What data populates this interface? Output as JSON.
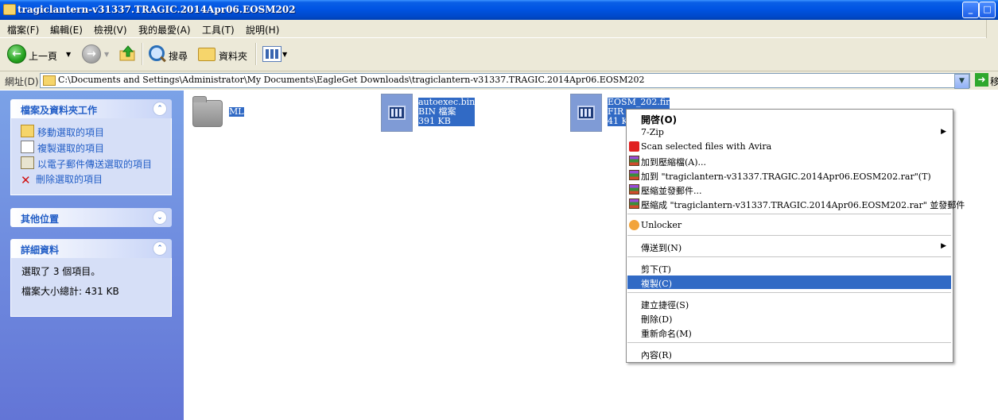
{
  "window": {
    "title": "tragiclantern-v31337.TRAGIC.2014Apr06.EOSM202",
    "min_label": "_",
    "max_label": "□"
  },
  "menu": [
    "檔案(F)",
    "編輯(E)",
    "檢視(V)",
    "我的最愛(A)",
    "工具(T)",
    "說明(H)"
  ],
  "toolbar": {
    "back_label": "上一頁",
    "search_label": "搜尋",
    "folders_label": "資料夾"
  },
  "address": {
    "label": "網址(D)",
    "path": "C:\\Documents and Settings\\Administrator\\My Documents\\EagleGet Downloads\\tragiclantern-v31337.TRAGIC.2014Apr06.EOSM202",
    "go_label": "移"
  },
  "taskpane": {
    "file_tasks": {
      "title": "檔案及資料夾工作",
      "items": [
        "移動選取的項目",
        "複製選取的項目",
        "以電子郵件傳送選取的項目",
        "刪除選取的項目"
      ]
    },
    "other_places": {
      "title": "其他位置"
    },
    "details": {
      "title": "詳細資料",
      "selected": "選取了 3 個項目。",
      "size": "檔案大小總計: 431 KB"
    }
  },
  "files": [
    {
      "name": "ML",
      "type": "folder"
    },
    {
      "name": "autoexec.bin",
      "type_label": "BIN 檔案",
      "size": "391 KB"
    },
    {
      "name": "EOSM_202.fir",
      "type_label": "FIR",
      "size": "41 K"
    }
  ],
  "context_menu": {
    "items": [
      {
        "label": "開啓(O)",
        "bold": true
      },
      {
        "label": "7-Zip",
        "submenu": true
      },
      {
        "label": "Scan selected files with Avira",
        "icon": "avira-icon"
      },
      {
        "label": "加到壓縮檔(A)...",
        "icon": "winrar-icon"
      },
      {
        "label": "加到 \"tragiclantern-v31337.TRAGIC.2014Apr06.EOSM202.rar\"(T)",
        "icon": "winrar-icon"
      },
      {
        "label": "壓縮並發郵件...",
        "icon": "winrar-icon"
      },
      {
        "label": "壓縮成 \"tragiclantern-v31337.TRAGIC.2014Apr06.EOSM202.rar\" 並發郵件",
        "icon": "winrar-icon"
      },
      {
        "label": "Unlocker",
        "icon": "unlocker-icon"
      },
      {
        "label": "傳送到(N)",
        "submenu": true
      },
      {
        "label": "剪下(T)"
      },
      {
        "label": "複製(C)",
        "highlighted": true
      },
      {
        "label": "建立捷徑(S)"
      },
      {
        "label": "刪除(D)"
      },
      {
        "label": "重新命名(M)"
      },
      {
        "label": "內容(R)"
      }
    ]
  },
  "colors": {
    "title_bar": "#0054e3",
    "taskpane": "#6f8ee0",
    "selection": "#316ac5",
    "menu_bg": "#ece9d8"
  }
}
